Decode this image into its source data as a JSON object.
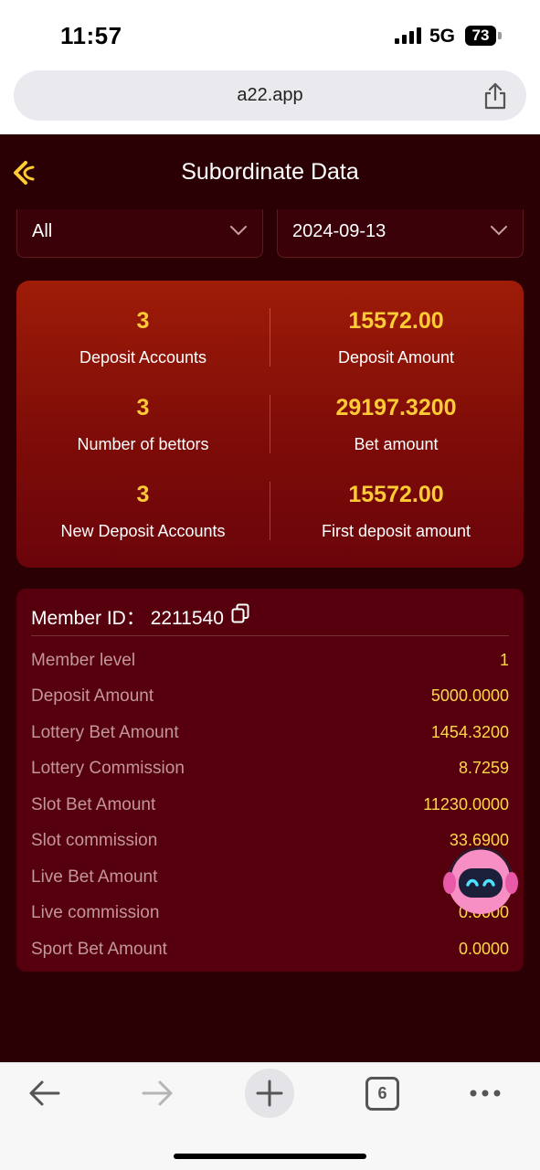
{
  "status_bar": {
    "time": "11:57",
    "network": "5G",
    "battery": "73"
  },
  "browser": {
    "url": "a22.app",
    "tab_count": "6"
  },
  "header": {
    "title": "Subordinate Data"
  },
  "filters": {
    "type_selected": "All",
    "date_selected": "2024-09-13"
  },
  "summary": [
    {
      "value": "3",
      "label": "Deposit Accounts"
    },
    {
      "value": "15572.00",
      "label": "Deposit Amount"
    },
    {
      "value": "3",
      "label": "Number of bettors"
    },
    {
      "value": "29197.3200",
      "label": "Bet amount"
    },
    {
      "value": "3",
      "label": "New Deposit Accounts"
    },
    {
      "value": "15572.00",
      "label": "First deposit amount"
    }
  ],
  "member": {
    "id_label": "Member ID：",
    "id_value": "2211540",
    "rows": [
      {
        "label": "Member level",
        "value": "1"
      },
      {
        "label": "Deposit Amount",
        "value": "5000.0000"
      },
      {
        "label": "Lottery Bet Amount",
        "value": "1454.3200"
      },
      {
        "label": "Lottery Commission",
        "value": "8.7259"
      },
      {
        "label": "Slot Bet Amount",
        "value": "11230.0000"
      },
      {
        "label": "Slot commission",
        "value": "33.6900"
      },
      {
        "label": "Live Bet Amount",
        "value": ""
      },
      {
        "label": "Live commission",
        "value": "0.0000"
      },
      {
        "label": "Sport Bet Amount",
        "value": "0.0000"
      }
    ]
  },
  "colors": {
    "background": "#2b0004",
    "accent": "#ffcc33",
    "card": "#55000c"
  }
}
